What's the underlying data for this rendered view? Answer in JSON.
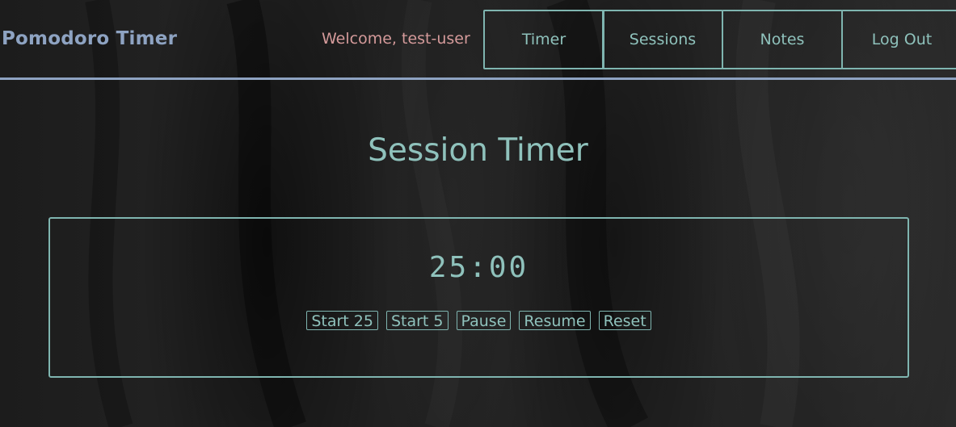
{
  "header": {
    "app_title": "Pomodoro Timer",
    "welcome": "Welcome, test-user",
    "nav": {
      "timer": "Timer",
      "sessions": "Sessions",
      "notes": "Notes",
      "logout": "Log Out"
    }
  },
  "main": {
    "title": "Session Timer",
    "timer": {
      "display": "25:00",
      "controls": {
        "start25": "Start 25",
        "start5": "Start 5",
        "pause": "Pause",
        "resume": "Resume",
        "reset": "Reset"
      }
    }
  },
  "colors": {
    "accent": "#7fb5b0",
    "header_title": "#8ea3c2",
    "welcome": "#d49a9a",
    "background": "#222222"
  }
}
